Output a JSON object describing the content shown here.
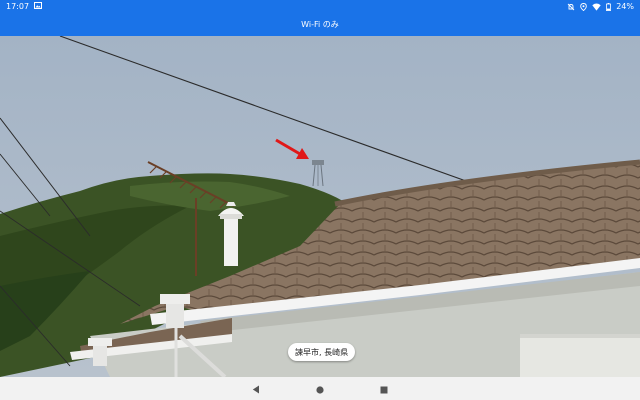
{
  "status_bar": {
    "time": "17:07",
    "left_icons": [
      "image-icon"
    ],
    "right_icons": [
      "mute-icon",
      "location-icon",
      "wifi-icon",
      "battery-icon"
    ],
    "battery_percent": "24%"
  },
  "title_bar": {
    "title": "Wi-Fi のみ",
    "color": "#1a73e8"
  },
  "photo": {
    "annotation_color": "#e01818"
  },
  "location_chip": {
    "text": "諫早市, 長崎県"
  },
  "nav_bar": {
    "buttons": [
      "back-icon",
      "home-icon",
      "recents-icon"
    ]
  }
}
